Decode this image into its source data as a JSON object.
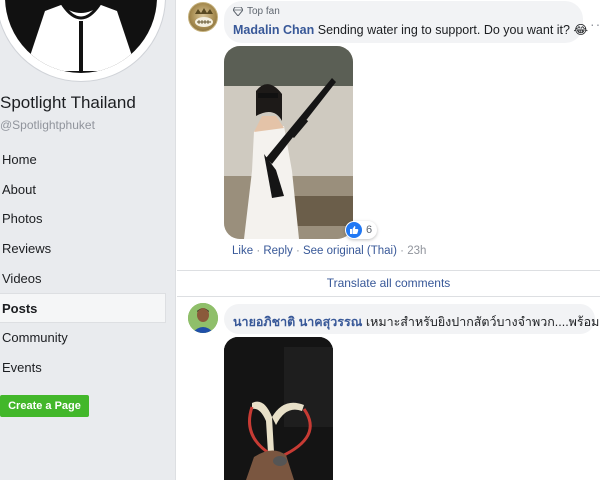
{
  "sidebar": {
    "page_name": "Spotlight Thailand",
    "handle": "@Spotlightphuket",
    "nav": [
      "Home",
      "About",
      "Photos",
      "Reviews",
      "Videos",
      "Posts",
      "Community",
      "Events"
    ],
    "active_nav": "Posts",
    "create_page_label": "Create a Page"
  },
  "comment1": {
    "badge": "Top fan",
    "author": "Madalin Chan",
    "text": "Sending water ing to support. Do you want it?",
    "emoji": "😂",
    "reaction_count": "6",
    "actions": {
      "like": "Like",
      "reply": "Reply",
      "see_original": "See original (Thai)",
      "time": "23h"
    }
  },
  "translate_all": "Translate all comments",
  "comment2": {
    "author": "นายอภิชาติ นาคสุวรรณ",
    "text": "เหมาะสำหรับยิงปากสัตว์บางจำพวก....พร้อมครับ"
  },
  "colors": {
    "link": "#385898",
    "sidebar_bg": "#e9ebee",
    "bubble_bg": "#f2f3f5",
    "create_btn": "#42b72a",
    "like_blue": "#2078f4"
  }
}
